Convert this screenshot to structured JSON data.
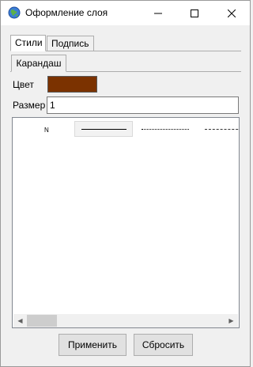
{
  "window": {
    "title": "Оформление слоя",
    "icon": "globe-icon",
    "controls": {
      "minimize": "minimize-icon",
      "maximize": "maximize-icon",
      "close": "close-icon"
    }
  },
  "tabs": [
    {
      "label": "Стили",
      "active": true
    },
    {
      "label": "Подпись",
      "active": false
    }
  ],
  "subtabs": [
    {
      "label": "Карандаш",
      "active": true
    }
  ],
  "fields": {
    "color_label": "Цвет",
    "color_value": "#7b3200",
    "size_label": "Размер",
    "size_value": "1"
  },
  "style_list": {
    "row_label": "N",
    "options": [
      "solid",
      "dotted",
      "dashed"
    ],
    "selected": "solid"
  },
  "buttons": {
    "apply": "Применить",
    "reset": "Сбросить"
  }
}
